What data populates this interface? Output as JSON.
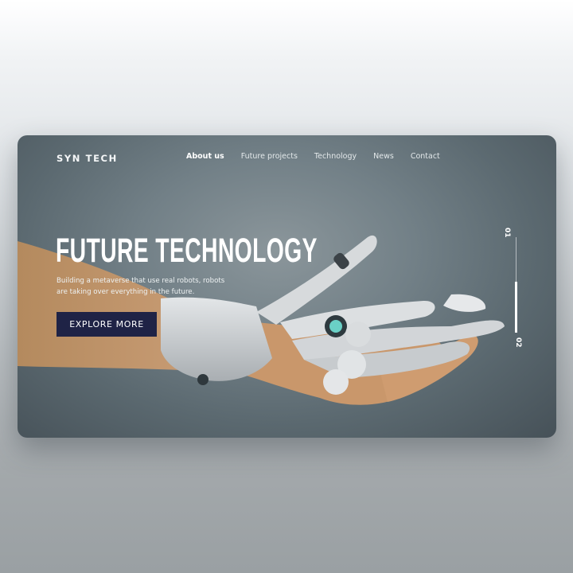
{
  "brand": {
    "logo": "SYN TECH"
  },
  "nav": {
    "items": [
      "About us",
      "Future projects",
      "Technology",
      "News",
      "Contact"
    ],
    "active": "About us"
  },
  "hero": {
    "title": "FUTURE TECHNOLOGY",
    "subtitle": "Building a metaverse that use real robots, robots are taking over everything in the future.",
    "cta": "EXPLORE MORE"
  },
  "pager": {
    "current": "01",
    "next": "02"
  },
  "colors": {
    "cta_bg": "#1f2346",
    "card_bg": "#5b6970",
    "text": "#ffffff"
  }
}
